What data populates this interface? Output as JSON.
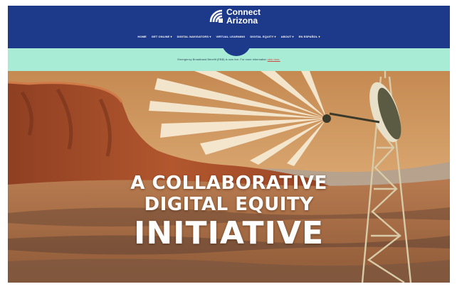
{
  "brand": {
    "line1": "Connect",
    "line2": "Arizona",
    "primary_color": "#1d3a8a"
  },
  "nav": {
    "items": [
      {
        "label": "HOME"
      },
      {
        "label": "GET ONLINE ▾"
      },
      {
        "label": "DIGITAL NAVIGATORS ▾"
      },
      {
        "label": "VIRTUAL LEARNING"
      },
      {
        "label": "DIGITAL EQUITY ▾"
      },
      {
        "label": "ABOUT ▾"
      },
      {
        "label": "EN ESPAÑOL ▾"
      }
    ]
  },
  "notice": {
    "text": "Emergency Broadband Benefit (EBB) is now live. For more information ",
    "link_label": "click here.",
    "background": "#a9ecd6"
  },
  "hero": {
    "line1": "A COLLABORATIVE",
    "line2": "DIGITAL EQUITY",
    "line3": "INITIATIVE"
  }
}
